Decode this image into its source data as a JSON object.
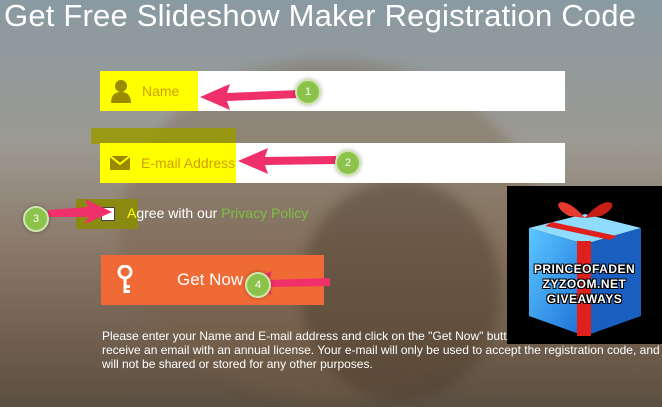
{
  "page": {
    "title": "Get Free Slideshow Maker Registration Code"
  },
  "form": {
    "name_placeholder": "Name",
    "email_placeholder": "E-mail Address",
    "agree_prefix_first": "A",
    "agree_prefix_rest": "gree with our ",
    "privacy_link": "Privacy Policy",
    "submit_label": "Get Now"
  },
  "info_text": "Please enter your Name and E-mail address and click on the \"Get Now\" button. In a few minutes, you will receive an email with an annual license. Your e-mail will only be used to accept the registration code, and will not be shared or stored for any other purposes.",
  "badges": [
    "1",
    "2",
    "3",
    "4"
  ],
  "giveaway": {
    "line1": "PRINCEOFADEN",
    "line2": "ZYZOOM.NET",
    "line3": "GIVEAWAYS"
  },
  "icons": [
    "user-icon",
    "envelope-icon",
    "key-icon",
    "gift-icon"
  ],
  "colors": {
    "button": "#f06a35",
    "highlight": "#ffff00",
    "arrow": "#f0306a",
    "badge": "#8bc34a",
    "link": "#7dc043"
  }
}
